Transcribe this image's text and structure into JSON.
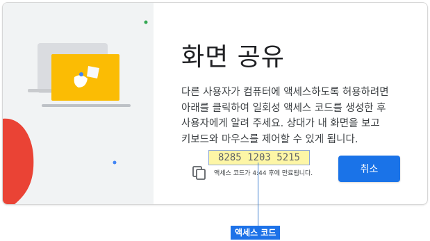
{
  "dialog": {
    "title": "화면 공유",
    "description": "다른 사용자가 컴퓨터에 액세스하도록 허용하려면 아래를 클릭하여 일회성 액세스 코드를 생성한 후 사용자에게 알려 주세요. 상대가 내 화면을 보고 키보드와 마우스를 제어할 수 있게 됩니다.",
    "access_code": "8285 1203 5215",
    "expiry_text": "액세스 코드가 4:44 후에 만료됩니다.",
    "cancel_label": "취소"
  },
  "annotation": {
    "label": "액세스 코드"
  },
  "icons": {
    "illustration": "screen-sharing-illustration-icon",
    "copy": "copy-icon"
  },
  "colors": {
    "primary": "#1a73e8",
    "left_panel": "#f1f3f4",
    "illustration_screen": "#fbbc04",
    "illustration_red": "#ea4335",
    "illustration_green": "#34a853",
    "highlight": "#fdf6a6"
  }
}
